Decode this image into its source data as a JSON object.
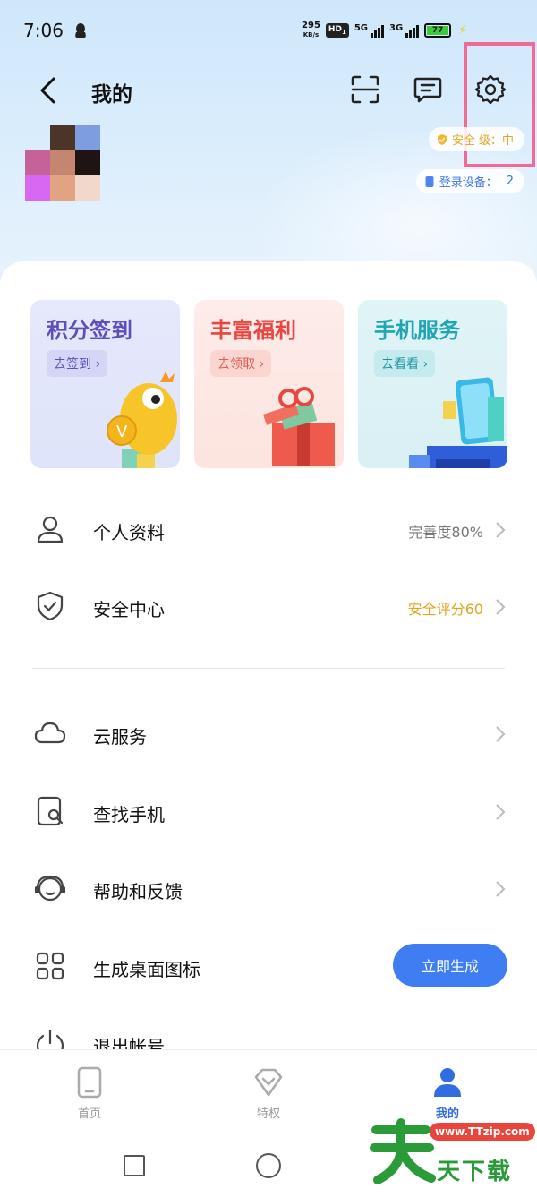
{
  "status_bar": {
    "time": "7:06",
    "speed_value": "295",
    "speed_unit": "KB/s",
    "hd": "HD",
    "hd_sub": "1",
    "net1": "5G",
    "net2": "3G",
    "battery": "77"
  },
  "header": {
    "title": "我的",
    "security_label": "安全",
    "security_label_tail": "级：中",
    "devices_label": "登录设备：",
    "devices_count": "2"
  },
  "promos": [
    {
      "title": "积分签到",
      "button": "去签到 ›"
    },
    {
      "title": "丰富福利",
      "button": "去领取 ›"
    },
    {
      "title": "手机服务",
      "button": "去看看 ›"
    }
  ],
  "menu": {
    "profile": {
      "label": "个人资料",
      "value": "完善度80%"
    },
    "security": {
      "label": "安全中心",
      "value": "安全评分60"
    },
    "cloud": {
      "label": "云服务"
    },
    "find_phone": {
      "label": "查找手机"
    },
    "help": {
      "label": "帮助和反馈"
    },
    "desktop_icon": {
      "label": "生成桌面图标",
      "button": "立即生成"
    },
    "logout": {
      "label": "退出帐号"
    }
  },
  "bottom_nav": [
    {
      "label": "首页"
    },
    {
      "label": "特权"
    },
    {
      "label": "我的"
    }
  ],
  "watermark": {
    "url": "www.TTzip.com",
    "text": "天下载"
  },
  "colors": {
    "accent": "#3e7ef2",
    "gold": "#e3a41c",
    "highlight": "#f06a94"
  }
}
